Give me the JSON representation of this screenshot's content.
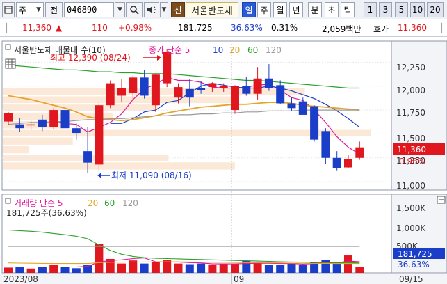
{
  "toolbar": {
    "mode_label": "주",
    "history_label": "전",
    "stock_code": "046890",
    "sin_label": "신",
    "stock_name": "서울반도체",
    "periods": [
      "일",
      "주",
      "월",
      "년",
      "분",
      "초",
      "틱"
    ],
    "selected_period": "일",
    "numbers": [
      "1",
      "3",
      "5",
      "10",
      "20"
    ]
  },
  "quote": {
    "price": "11,360",
    "change": "110",
    "change_pct": "+0.98%",
    "volume": "181,725",
    "volume_pct": "36.63%",
    "turnover_pct": "0.31%",
    "amount": "2,059백만",
    "ask_label": "호가",
    "ask_price": "11,360",
    "colors": {
      "up": "#e0171f",
      "down": "#1b3ec9"
    }
  },
  "chart": {
    "price_panel": {
      "stock_label": "서울반도체 매물대 수(10)",
      "ma_label": "종가 단순 5",
      "ma_periods": [
        "10",
        "20",
        "60",
        "120"
      ],
      "high_label": "최고 12,390 (08/24)",
      "low_label": "최저 11,090 (08/16)",
      "current_price": "11,360",
      "current_change_pct": "0.98%",
      "y_ticks": [
        "12,250",
        "12,000",
        "11,750",
        "11,500",
        "11,250",
        "11,000"
      ]
    },
    "volume_panel": {
      "label": "거래량 단순 5",
      "ma_periods": [
        "20",
        "60",
        "120"
      ],
      "info": "181,725주(36.63%)",
      "current_volume": "181,725",
      "current_pct": "36.63%",
      "y_ticks": [
        "1,500K",
        "1,000K",
        "500K"
      ]
    },
    "x_labels": [
      "2023/08",
      "09",
      "09/15"
    ]
  },
  "chart_data": {
    "type": "candlestick",
    "ylim": [
      10950,
      12420
    ],
    "candles": [
      {
        "o": 11630,
        "h": 11730,
        "l": 11590,
        "c": 11720
      },
      {
        "o": 11600,
        "h": 11670,
        "l": 11520,
        "c": 11560
      },
      {
        "o": 11590,
        "h": 11650,
        "l": 11540,
        "c": 11600
      },
      {
        "o": 11650,
        "h": 11700,
        "l": 11530,
        "c": 11570
      },
      {
        "o": 11570,
        "h": 11770,
        "l": 11550,
        "c": 11750
      },
      {
        "o": 11750,
        "h": 11760,
        "l": 11540,
        "c": 11560
      },
      {
        "o": 11560,
        "h": 11620,
        "l": 11440,
        "c": 11510
      },
      {
        "o": 11320,
        "h": 11570,
        "l": 11090,
        "c": 11200
      },
      {
        "o": 11180,
        "h": 11830,
        "l": 11100,
        "c": 11800
      },
      {
        "o": 11800,
        "h": 12060,
        "l": 11770,
        "c": 12030
      },
      {
        "o": 11900,
        "h": 12070,
        "l": 11830,
        "c": 11980
      },
      {
        "o": 11930,
        "h": 12110,
        "l": 11860,
        "c": 12090
      },
      {
        "o": 12090,
        "h": 12170,
        "l": 11870,
        "c": 11900
      },
      {
        "o": 11800,
        "h": 12130,
        "l": 11730,
        "c": 12120
      },
      {
        "o": 12030,
        "h": 12390,
        "l": 11990,
        "c": 12360
      },
      {
        "o": 11880,
        "h": 12030,
        "l": 11820,
        "c": 11990
      },
      {
        "o": 11970,
        "h": 12070,
        "l": 11790,
        "c": 11880
      },
      {
        "o": 11980,
        "h": 12050,
        "l": 11920,
        "c": 11960
      },
      {
        "o": 11990,
        "h": 12040,
        "l": 11940,
        "c": 12030
      },
      {
        "o": 11980,
        "h": 12030,
        "l": 11940,
        "c": 12000
      },
      {
        "o": 11750,
        "h": 12010,
        "l": 11710,
        "c": 12000
      },
      {
        "o": 12000,
        "h": 12100,
        "l": 11900,
        "c": 11920
      },
      {
        "o": 11920,
        "h": 12200,
        "l": 11860,
        "c": 12080
      },
      {
        "o": 12080,
        "h": 12230,
        "l": 11950,
        "c": 11980
      },
      {
        "o": 12010,
        "h": 12060,
        "l": 11810,
        "c": 11820
      },
      {
        "o": 11820,
        "h": 11880,
        "l": 11740,
        "c": 11770
      },
      {
        "o": 11840,
        "h": 11880,
        "l": 11720,
        "c": 11700
      },
      {
        "o": 11790,
        "h": 11800,
        "l": 11420,
        "c": 11440
      },
      {
        "o": 11530,
        "h": 11560,
        "l": 11190,
        "c": 11250
      },
      {
        "o": 11250,
        "h": 11320,
        "l": 11120,
        "c": 11140
      },
      {
        "o": 11150,
        "h": 11280,
        "l": 11140,
        "c": 11240
      },
      {
        "o": 11250,
        "h": 11420,
        "l": 11230,
        "c": 11360
      }
    ],
    "volume_ylim": [
      0,
      1750000
    ],
    "volumes": [
      170000,
      200000,
      140000,
      180000,
      250000,
      190000,
      150000,
      260000,
      920000,
      450000,
      300000,
      400000,
      300000,
      350000,
      420000,
      300000,
      280000,
      300000,
      250000,
      300000,
      290000,
      380000,
      320000,
      260000,
      260000,
      300000,
      270000,
      340000,
      410000,
      330000,
      560000,
      181725
    ],
    "ma": [
      {
        "period": "5",
        "color": "#e0179a",
        "values": [
          null,
          null,
          null,
          null,
          11640,
          11610,
          11600,
          11520,
          11570,
          11620,
          11710,
          11860,
          11970,
          12020,
          12090,
          12060,
          12060,
          12040,
          11990,
          11980,
          11980,
          11990,
          12010,
          12020,
          11960,
          11880,
          11850,
          11750,
          11620,
          11470,
          11360,
          11290
        ]
      },
      {
        "period": "10",
        "color": "#1b3ec9",
        "values": [
          null,
          null,
          null,
          null,
          null,
          null,
          null,
          null,
          null,
          11610,
          11610,
          11660,
          11730,
          11750,
          11830,
          11850,
          11930,
          12000,
          12030,
          12010,
          11990,
          11980,
          11980,
          12000,
          11980,
          11950,
          11910,
          11870,
          11810,
          11740,
          11660,
          11570
        ]
      },
      {
        "period": "20",
        "color": "#e5a52a",
        "values": [
          11900,
          11880,
          11860,
          11830,
          11800,
          11770,
          11730,
          11680,
          11660,
          11650,
          11640,
          11650,
          11670,
          11690,
          11720,
          11740,
          11760,
          11780,
          11790,
          11800,
          11810,
          11810,
          11820,
          11830,
          11830,
          11820,
          11800,
          11790,
          11780,
          11770,
          11760,
          11750
        ]
      },
      {
        "period": "60",
        "color": "#2aa02a",
        "values": [
          12220,
          12210,
          12200,
          12190,
          12180,
          12170,
          12170,
          12160,
          12150,
          12150,
          12140,
          12140,
          12130,
          12130,
          12130,
          12120,
          12110,
          12100,
          12090,
          12080,
          12070,
          12060,
          12060,
          12050,
          12040,
          12030,
          12020,
          12010,
          12000,
          11990,
          11980,
          11980
        ]
      },
      {
        "period": "120",
        "color": "#9a9a9a",
        "values": [
          11600,
          11610,
          11620,
          11620,
          11630,
          11630,
          11640,
          11650,
          11650,
          11660,
          11660,
          11670,
          11680,
          11690,
          11690,
          11700,
          11700,
          11710,
          11710,
          11720,
          11720,
          11730,
          11730,
          11740,
          11740,
          11740,
          11750,
          11750,
          11750,
          11750,
          11750,
          11750
        ]
      }
    ],
    "volume_ma": [
      {
        "period": "5",
        "color": "#e0179a",
        "values": [
          null,
          null,
          null,
          null,
          190000,
          190000,
          190000,
          210000,
          350000,
          400000,
          420000,
          460000,
          480000,
          360000,
          350000,
          350000,
          330000,
          320000,
          290000,
          290000,
          290000,
          300000,
          310000,
          310000,
          300000,
          300000,
          280000,
          300000,
          320000,
          320000,
          380000,
          360000
        ]
      },
      {
        "period": "20",
        "color": "#e5a52a",
        "values": [
          320000,
          315000,
          310000,
          305000,
          300000,
          300000,
          300000,
          300000,
          330000,
          340000,
          345000,
          350000,
          350000,
          352000,
          355000,
          355000,
          350000,
          345000,
          340000,
          340000,
          335000,
          330000,
          330000,
          325000,
          320000,
          315000,
          310000,
          305000,
          305000,
          300000,
          300000,
          300000
        ]
      },
      {
        "period": "60",
        "color": "#2aa02a",
        "values": [
          1380000,
          1360000,
          1340000,
          1310000,
          1270000,
          1230000,
          1180000,
          1100000,
          900000,
          720000,
          600000,
          530000,
          490000,
          470000,
          460000,
          450000,
          440000,
          430000,
          420000,
          410000,
          400000,
          390000,
          380000,
          370000,
          360000,
          350000,
          345000,
          340000,
          335000,
          330000,
          325000,
          320000
        ]
      },
      {
        "period": "120",
        "color": "#9a9a9a",
        "values": [
          850000,
          850000,
          850000,
          850000,
          850000,
          850000,
          850000,
          850000,
          850000,
          850000,
          850000,
          850000,
          850000,
          850000,
          850000,
          850000,
          850000,
          850000,
          850000,
          850000,
          850000,
          850000,
          850000,
          850000,
          850000,
          850000,
          850000,
          850000,
          850000,
          850000,
          850000,
          850000
        ]
      }
    ],
    "volume_profile": [
      {
        "low": 11900,
        "high": 11990,
        "level": 0.82
      },
      {
        "low": 11815,
        "high": 11900,
        "level": 0.64
      },
      {
        "low": 11730,
        "high": 11815,
        "level": 0.42
      },
      {
        "low": 11640,
        "high": 11730,
        "level": 0.3
      },
      {
        "low": 11550,
        "high": 11640,
        "level": 0.17
      },
      {
        "low": 11470,
        "high": 11550,
        "level": 1.0
      },
      {
        "low": 11380,
        "high": 11470,
        "level": 0.19
      },
      {
        "low": 11290,
        "high": 11380,
        "level": 0.07
      },
      {
        "low": 11210,
        "high": 11290,
        "level": 0.45
      },
      {
        "low": 11120,
        "high": 11210,
        "level": 0.63
      }
    ]
  }
}
